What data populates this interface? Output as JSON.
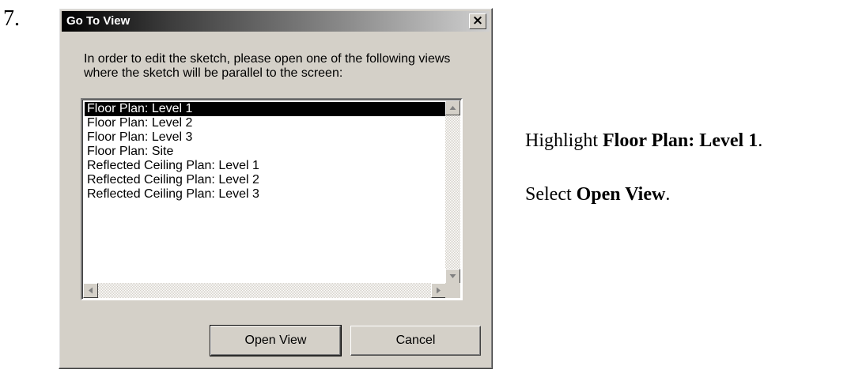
{
  "step": {
    "number": "7."
  },
  "dialog": {
    "title": "Go To View",
    "close_glyph": "×",
    "message": "In order to edit the sketch, please open one of the following views where the sketch will be parallel to the screen:",
    "views": [
      "Floor Plan: Level 1",
      "Floor Plan: Level 2",
      "Floor Plan: Level 3",
      "Floor Plan: Site",
      "Reflected Ceiling Plan: Level 1",
      "Reflected Ceiling Plan: Level 2",
      "Reflected Ceiling Plan: Level 3"
    ],
    "selected_index": 0,
    "open_view_label": "Open View",
    "cancel_label": "Cancel",
    "icons": {
      "close": "close-icon",
      "scroll_up": "arrow-up-icon",
      "scroll_down": "arrow-down-icon",
      "scroll_left": "arrow-left-icon",
      "scroll_right": "arrow-right-icon"
    }
  },
  "instructions": {
    "line1_prefix": "Highlight ",
    "line1_bold": "Floor Plan: Level 1",
    "line1_suffix": ".",
    "line2_prefix": "Select ",
    "line2_bold": "Open View",
    "line2_suffix": "."
  },
  "colors": {
    "dialog_face": "#d4d0c8",
    "titlebar_start": "#000000",
    "titlebar_end": "#d0d0d0",
    "selection": "#000000"
  }
}
